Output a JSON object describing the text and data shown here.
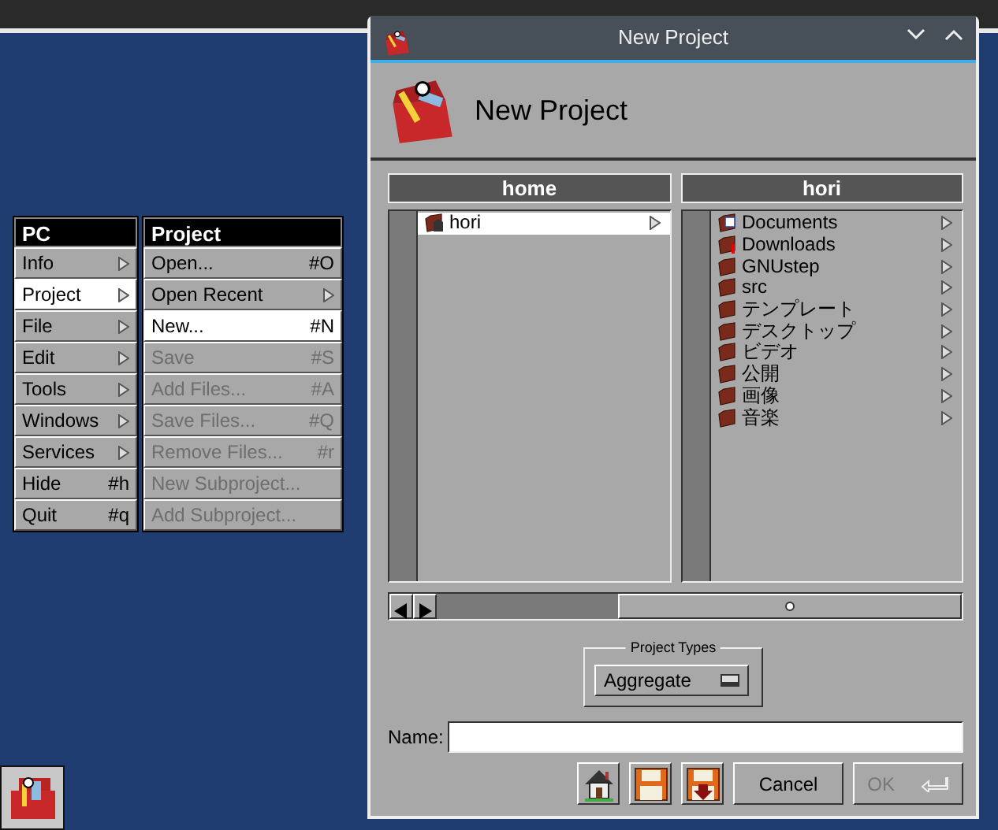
{
  "menus": [
    {
      "title": "PC",
      "items": [
        {
          "label": "Info",
          "submenu": true,
          "selected": false,
          "disabled": false
        },
        {
          "label": "Project",
          "submenu": true,
          "selected": true,
          "disabled": false
        },
        {
          "label": "File",
          "submenu": true,
          "selected": false,
          "disabled": false
        },
        {
          "label": "Edit",
          "submenu": true,
          "selected": false,
          "disabled": false
        },
        {
          "label": "Tools",
          "submenu": true,
          "selected": false,
          "disabled": false
        },
        {
          "label": "Windows",
          "submenu": true,
          "selected": false,
          "disabled": false
        },
        {
          "label": "Services",
          "submenu": true,
          "selected": false,
          "disabled": false
        },
        {
          "label": "Hide",
          "shortcut": "#h",
          "submenu": false,
          "selected": false,
          "disabled": false
        },
        {
          "label": "Quit",
          "shortcut": "#q",
          "submenu": false,
          "selected": false,
          "disabled": false
        }
      ]
    },
    {
      "title": "Project",
      "items": [
        {
          "label": "Open...",
          "shortcut": "#O",
          "submenu": false,
          "selected": false,
          "disabled": false
        },
        {
          "label": "Open Recent",
          "submenu": true,
          "selected": false,
          "disabled": false
        },
        {
          "label": "New...",
          "shortcut": "#N",
          "submenu": false,
          "selected": true,
          "disabled": false
        },
        {
          "label": "Save",
          "shortcut": "#S",
          "submenu": false,
          "selected": false,
          "disabled": true
        },
        {
          "label": "Add Files...",
          "shortcut": "#A",
          "submenu": false,
          "selected": false,
          "disabled": true
        },
        {
          "label": "Save Files...",
          "shortcut": "#Q",
          "submenu": false,
          "selected": false,
          "disabled": true
        },
        {
          "label": "Remove Files...",
          "shortcut": "#r",
          "submenu": false,
          "selected": false,
          "disabled": true
        },
        {
          "label": "New Subproject...",
          "submenu": false,
          "selected": false,
          "disabled": true
        },
        {
          "label": "Add Subproject...",
          "submenu": false,
          "selected": false,
          "disabled": true
        }
      ]
    }
  ],
  "dialog": {
    "window_title": "New Project",
    "heading": "New Project",
    "browser_columns": [
      {
        "title": "home",
        "items": [
          {
            "label": "hori",
            "kind": "home",
            "selected": true
          }
        ]
      },
      {
        "title": "hori",
        "items": [
          {
            "label": "Documents",
            "kind": "documents",
            "selected": false
          },
          {
            "label": "Downloads",
            "kind": "downloads",
            "selected": false
          },
          {
            "label": "GNUstep",
            "kind": "folder",
            "selected": false
          },
          {
            "label": "src",
            "kind": "folder",
            "selected": false
          },
          {
            "label": "テンプレート",
            "kind": "folder",
            "selected": false
          },
          {
            "label": "デスクトップ",
            "kind": "folder",
            "selected": false
          },
          {
            "label": "ビデオ",
            "kind": "folder",
            "selected": false
          },
          {
            "label": "公開",
            "kind": "folder",
            "selected": false
          },
          {
            "label": "画像",
            "kind": "folder",
            "selected": false
          },
          {
            "label": "音楽",
            "kind": "folder",
            "selected": false
          }
        ]
      }
    ],
    "project_types": {
      "label": "Project Types",
      "value": "Aggregate"
    },
    "name_field": {
      "label": "Name:"
    },
    "buttons": [
      {
        "kind": "home"
      },
      {
        "kind": "save"
      },
      {
        "kind": "save-down"
      },
      {
        "kind": "text",
        "label": "Cancel",
        "disabled": false
      },
      {
        "kind": "text",
        "label": "OK",
        "disabled": true
      }
    ]
  }
}
